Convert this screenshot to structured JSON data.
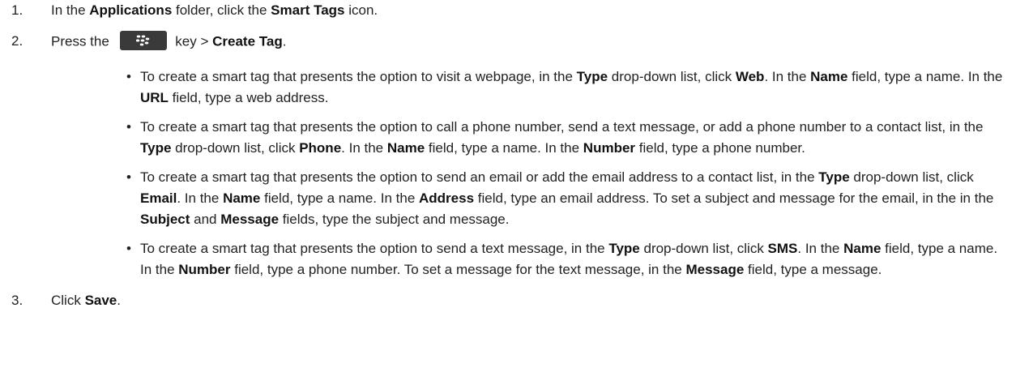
{
  "steps": [
    {
      "number": "1.",
      "parts": [
        {
          "t": "In the "
        },
        {
          "b": "Applications"
        },
        {
          "t": " folder, click the "
        },
        {
          "b": "Smart Tags"
        },
        {
          "t": " icon."
        }
      ]
    },
    {
      "number": "2.",
      "before_key": "Press the",
      "key_icon": "blackberry-menu-key-icon",
      "after_key": [
        {
          "t": " key > "
        },
        {
          "b": "Create Tag"
        },
        {
          "t": "."
        }
      ],
      "bullets": [
        [
          {
            "t": "To create a smart tag that presents the option to visit a webpage, in the "
          },
          {
            "b": "Type"
          },
          {
            "t": " drop-down list, click "
          },
          {
            "b": "Web"
          },
          {
            "t": ". In the "
          },
          {
            "b": "Name"
          },
          {
            "t": " field, type a name. In the "
          },
          {
            "b": "URL"
          },
          {
            "t": " field, type a web address."
          }
        ],
        [
          {
            "t": "To create a smart tag that presents the option to call a phone number, send a text message, or add a phone number to a contact list, in the "
          },
          {
            "b": "Type"
          },
          {
            "t": " drop-down list, click "
          },
          {
            "b": "Phone"
          },
          {
            "t": ". In the "
          },
          {
            "b": "Name"
          },
          {
            "t": " field, type a name. In the "
          },
          {
            "b": "Number"
          },
          {
            "t": " field, type a phone number."
          }
        ],
        [
          {
            "t": "To create a smart tag that presents the option to send an email or add the email address to a contact list, in the "
          },
          {
            "b": "Type"
          },
          {
            "t": " drop-down list, click "
          },
          {
            "b": "Email"
          },
          {
            "t": ". In the "
          },
          {
            "b": "Name"
          },
          {
            "t": " field, type a name. In the "
          },
          {
            "b": "Address"
          },
          {
            "t": " field, type an email address. To set a subject and message for the email, in the in the "
          },
          {
            "b": "Subject"
          },
          {
            "t": " and "
          },
          {
            "b": "Message"
          },
          {
            "t": " fields, type the subject and message."
          }
        ],
        [
          {
            "t": "To create a smart tag that presents the option to send a text message, in the "
          },
          {
            "b": "Type"
          },
          {
            "t": " drop-down list, click "
          },
          {
            "b": "SMS"
          },
          {
            "t": ". In the "
          },
          {
            "b": "Name"
          },
          {
            "t": " field, type a name. In the "
          },
          {
            "b": "Number"
          },
          {
            "t": " field, type a phone number. To set a message for the text message, in the "
          },
          {
            "b": "Message"
          },
          {
            "t": " field, type a message."
          }
        ]
      ]
    },
    {
      "number": "3.",
      "parts": [
        {
          "t": "Click "
        },
        {
          "b": "Save"
        },
        {
          "t": "."
        }
      ]
    }
  ],
  "bullet_glyph": "•"
}
